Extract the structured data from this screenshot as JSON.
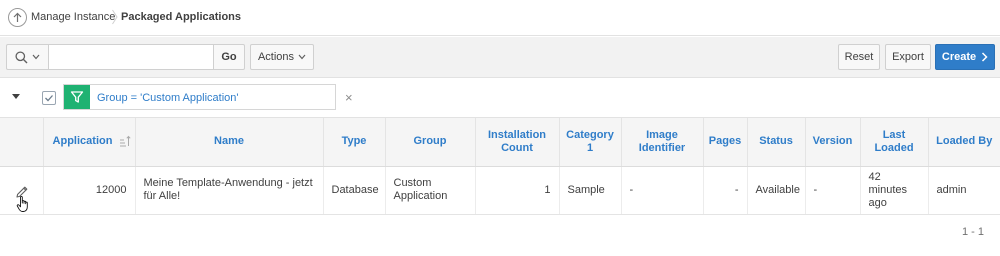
{
  "breadcrumb": {
    "parent": "Manage Instance",
    "current": "Packaged Applications"
  },
  "toolbar": {
    "search_placeholder": "",
    "go_label": "Go",
    "actions_label": "Actions",
    "reset_label": "Reset",
    "export_label": "Export",
    "create_label": "Create"
  },
  "filter": {
    "expression": "Group = 'Custom Application'",
    "enabled": true,
    "remove_glyph": "×"
  },
  "table": {
    "columns": [
      "",
      "Application",
      "Name",
      "Type",
      "Group",
      "Installation Count",
      "Category 1",
      "Image Identifier",
      "Pages",
      "Status",
      "Version",
      "Last Loaded",
      "Loaded By"
    ],
    "sorted_column": "Application",
    "sort_direction": "ascending",
    "rows": [
      {
        "application": "12000",
        "name": "Meine Template-Anwendung - jetzt für Alle!",
        "type": "Database",
        "group": "Custom Application",
        "installation_count": "1",
        "category1": "Sample",
        "image_identifier": "-",
        "pages": "-",
        "status": "Available",
        "version": "-",
        "last_loaded": "42 minutes ago",
        "loaded_by": "admin"
      }
    ]
  },
  "pagination": "1 - 1",
  "colors": {
    "accent": "#2f7dc9",
    "filter_green": "#1fb272",
    "header_bg": "#f5f5f5"
  },
  "icons": [
    "up-arrow-icon",
    "chevron-right-icon",
    "search-icon",
    "chevron-down-icon",
    "filter-funnel-icon",
    "checkmark-icon",
    "sort-ascending-icon",
    "edit-pencil-icon",
    "hand-cursor-icon"
  ]
}
